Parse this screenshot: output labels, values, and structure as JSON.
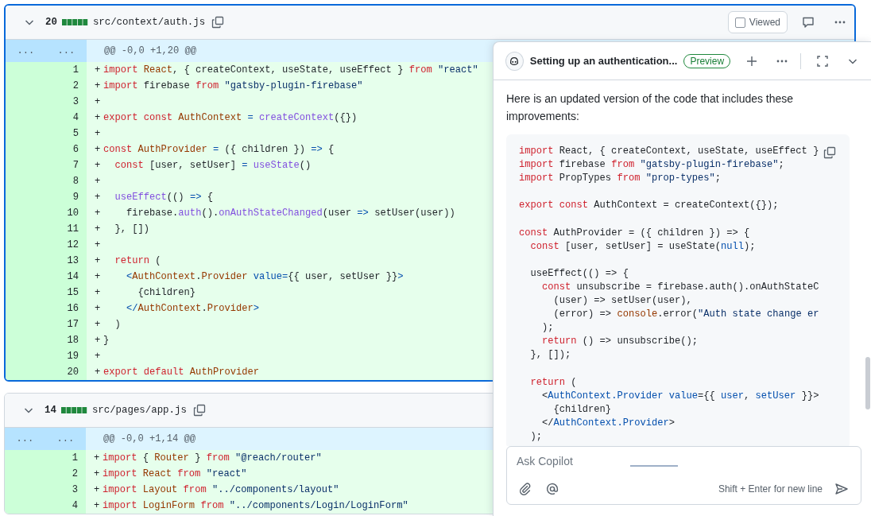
{
  "files": [
    {
      "focused": true,
      "collapsed": false,
      "count": "20",
      "path": "src/context/auth.js",
      "viewed": false,
      "viewed_label": "Viewed",
      "hunk": {
        "old_marker": "...",
        "new_marker": "...",
        "header": "@@ -0,0 +1,20 @@"
      },
      "lines": [
        {
          "number": "1",
          "sign": "+",
          "tokens": [
            {
              "text": "import",
              "kind": "keyword"
            },
            {
              "text": " React",
              "kind": "entity"
            },
            {
              "text": ", { createContext, useState, useEffect } "
            },
            {
              "text": "from",
              "kind": "keyword"
            },
            {
              "text": " \"react\"",
              "kind": "string"
            }
          ]
        },
        {
          "number": "2",
          "sign": "+",
          "tokens": [
            {
              "text": "import",
              "kind": "keyword"
            },
            {
              "text": " firebase "
            },
            {
              "text": "from",
              "kind": "keyword"
            },
            {
              "text": " \"gatsby-plugin-firebase\"",
              "kind": "string"
            }
          ]
        },
        {
          "number": "3",
          "sign": "+"
        },
        {
          "number": "4",
          "sign": "+",
          "tokens": [
            {
              "text": "export",
              "kind": "keyword"
            },
            {
              "text": " const",
              "kind": "keyword"
            },
            {
              "text": " AuthContext",
              "kind": "entity"
            },
            {
              "text": " =",
              "kind": "constant"
            },
            {
              "text": " createContext",
              "kind": "function"
            },
            {
              "text": "({})"
            }
          ]
        },
        {
          "number": "5",
          "sign": "+"
        },
        {
          "number": "6",
          "sign": "+",
          "tokens": [
            {
              "text": "const",
              "kind": "keyword"
            },
            {
              "text": " AuthProvider",
              "kind": "entity"
            },
            {
              "text": " =",
              "kind": "constant"
            },
            {
              "text": " ({ children }) "
            },
            {
              "text": "=>",
              "kind": "constant"
            },
            {
              "text": " {"
            }
          ]
        },
        {
          "number": "7",
          "sign": "+",
          "tokens": [
            {
              "text": "  const",
              "kind": "keyword"
            },
            {
              "text": " [user, setUser] "
            },
            {
              "text": "=",
              "kind": "constant"
            },
            {
              "text": " useState",
              "kind": "function"
            },
            {
              "text": "()"
            }
          ]
        },
        {
          "number": "8",
          "sign": "+"
        },
        {
          "number": "9",
          "sign": "+",
          "tokens": [
            {
              "text": "  useEffect",
              "kind": "function"
            },
            {
              "text": "(() "
            },
            {
              "text": "=>",
              "kind": "constant"
            },
            {
              "text": " {"
            }
          ]
        },
        {
          "number": "10",
          "sign": "+",
          "tokens": [
            {
              "text": "    firebase."
            },
            {
              "text": "auth",
              "kind": "function"
            },
            {
              "text": "()."
            },
            {
              "text": "onAuthStateChanged",
              "kind": "function"
            },
            {
              "text": "(user "
            },
            {
              "text": "=>",
              "kind": "constant"
            },
            {
              "text": " setUser(user))"
            }
          ]
        },
        {
          "number": "11",
          "sign": "+",
          "tokens": [
            {
              "text": "  }, [])"
            }
          ]
        },
        {
          "number": "12",
          "sign": "+"
        },
        {
          "number": "13",
          "sign": "+",
          "tokens": [
            {
              "text": "  return",
              "kind": "keyword"
            },
            {
              "text": " ("
            }
          ]
        },
        {
          "number": "14",
          "sign": "+",
          "tokens": [
            {
              "text": "    <",
              "kind": "constant"
            },
            {
              "text": "AuthContext",
              "kind": "entity"
            },
            {
              "text": "."
            },
            {
              "text": "Provider",
              "kind": "entity"
            },
            {
              "text": " value=",
              "kind": "constant"
            },
            {
              "text": "{{ user, setUser }}"
            },
            {
              "text": ">",
              "kind": "constant"
            }
          ]
        },
        {
          "number": "15",
          "sign": "+",
          "tokens": [
            {
              "text": "      {children}"
            }
          ]
        },
        {
          "number": "16",
          "sign": "+",
          "tokens": [
            {
              "text": "    </",
              "kind": "constant"
            },
            {
              "text": "AuthContext",
              "kind": "entity"
            },
            {
              "text": "."
            },
            {
              "text": "Provider",
              "kind": "entity"
            },
            {
              "text": ">",
              "kind": "constant"
            }
          ]
        },
        {
          "number": "17",
          "sign": "+",
          "tokens": [
            {
              "text": "  )"
            }
          ]
        },
        {
          "number": "18",
          "sign": "+",
          "tokens": [
            {
              "text": "}"
            }
          ]
        },
        {
          "number": "19",
          "sign": "+"
        },
        {
          "number": "20",
          "sign": "+",
          "tokens": [
            {
              "text": "export",
              "kind": "keyword"
            },
            {
              "text": " default",
              "kind": "keyword"
            },
            {
              "text": " AuthProvider",
              "kind": "entity"
            }
          ]
        }
      ]
    },
    {
      "focused": false,
      "collapsed": false,
      "count": "14",
      "path": "src/pages/app.js",
      "hunk": {
        "old_marker": "...",
        "new_marker": "...",
        "header": "@@ -0,0 +1,14 @@"
      },
      "lines": [
        {
          "number": "1",
          "sign": "+",
          "tokens": [
            {
              "text": "import",
              "kind": "keyword"
            },
            {
              "text": " { "
            },
            {
              "text": "Router",
              "kind": "entity"
            },
            {
              "text": " } "
            },
            {
              "text": "from",
              "kind": "keyword"
            },
            {
              "text": " \"@reach/router\"",
              "kind": "string"
            }
          ]
        },
        {
          "number": "2",
          "sign": "+",
          "tokens": [
            {
              "text": "import",
              "kind": "keyword"
            },
            {
              "text": " React",
              "kind": "entity"
            },
            {
              "text": " from",
              "kind": "keyword"
            },
            {
              "text": " \"react\"",
              "kind": "string"
            }
          ]
        },
        {
          "number": "3",
          "sign": "+",
          "tokens": [
            {
              "text": "import",
              "kind": "keyword"
            },
            {
              "text": " Layout",
              "kind": "entity"
            },
            {
              "text": " from",
              "kind": "keyword"
            },
            {
              "text": " \"../components/layout\"",
              "kind": "string"
            }
          ]
        },
        {
          "number": "4",
          "sign": "+",
          "tokens": [
            {
              "text": "import",
              "kind": "keyword"
            },
            {
              "text": " LoginForm",
              "kind": "entity"
            },
            {
              "text": " from",
              "kind": "keyword"
            },
            {
              "text": " \"../components/Login/LoginForm\"",
              "kind": "string"
            }
          ]
        }
      ]
    }
  ],
  "copilot": {
    "title": "Setting up an authentication...",
    "badge": "Preview",
    "message": "Here is an updated version of the code that includes these improvements:",
    "code": [
      {
        "tokens": [
          {
            "text": "import",
            "kind": "keyword"
          },
          {
            "text": " React, { createContext, useState, useEffect }"
          }
        ]
      },
      {
        "tokens": [
          {
            "text": "import",
            "kind": "keyword"
          },
          {
            "text": " firebase "
          },
          {
            "text": "from",
            "kind": "keyword"
          },
          {
            "text": " \"gatsby-plugin-firebase\"",
            "kind": "string"
          },
          {
            "text": ";"
          }
        ]
      },
      {
        "tokens": [
          {
            "text": "import",
            "kind": "keyword"
          },
          {
            "text": " PropTypes "
          },
          {
            "text": "from",
            "kind": "keyword"
          },
          {
            "text": " \"prop-types\"",
            "kind": "string"
          },
          {
            "text": ";"
          }
        ]
      },
      {
        "blank_before": true,
        "tokens": [
          {
            "text": "export",
            "kind": "keyword"
          },
          {
            "text": " const",
            "kind": "keyword"
          },
          {
            "text": " AuthContext = createContext({});"
          }
        ]
      },
      {
        "blank_before": true,
        "tokens": [
          {
            "text": "const",
            "kind": "keyword"
          },
          {
            "text": " AuthProvider = ({ children }) => {"
          }
        ]
      },
      {
        "tokens": [
          {
            "text": "  const",
            "kind": "keyword"
          },
          {
            "text": " [user, setUser] = useState("
          },
          {
            "text": "null",
            "kind": "constant"
          },
          {
            "text": ");"
          }
        ]
      },
      {
        "blank_before": true,
        "tokens": [
          {
            "text": "  useEffect(() => {"
          }
        ]
      },
      {
        "tokens": [
          {
            "text": "    const",
            "kind": "keyword"
          },
          {
            "text": " unsubscribe = firebase.auth().onAuthStateC"
          }
        ]
      },
      {
        "tokens": [
          {
            "text": "      (user) => setUser(user),"
          }
        ]
      },
      {
        "tokens": [
          {
            "text": "      (error) => "
          },
          {
            "text": "console",
            "kind": "entity"
          },
          {
            "text": ".error("
          },
          {
            "text": "\"Auth state change er",
            "kind": "string"
          }
        ]
      },
      {
        "tokens": [
          {
            "text": "    );"
          }
        ]
      },
      {
        "tokens": [
          {
            "text": "    return",
            "kind": "keyword"
          },
          {
            "text": " () => unsubscribe();"
          }
        ]
      },
      {
        "tokens": [
          {
            "text": "  }, []);"
          }
        ]
      },
      {
        "blank_before": true,
        "tokens": [
          {
            "text": "  return",
            "kind": "keyword"
          },
          {
            "text": " ("
          }
        ]
      },
      {
        "tokens": [
          {
            "text": "    <"
          },
          {
            "text": "AuthContext.Provider value",
            "kind": "constant"
          },
          {
            "text": "={{ "
          },
          {
            "text": "user",
            "kind": "constant"
          },
          {
            "text": ", "
          },
          {
            "text": "setUser",
            "kind": "constant"
          },
          {
            "text": " }}>"
          }
        ]
      },
      {
        "tokens": [
          {
            "text": "      {children}"
          }
        ]
      },
      {
        "tokens": [
          {
            "text": "    </"
          },
          {
            "text": "AuthContext.Provider",
            "kind": "constant"
          },
          {
            "text": ">"
          }
        ]
      },
      {
        "tokens": [
          {
            "text": "  );"
          }
        ]
      }
    ],
    "input": {
      "placeholder": "Ask Copilot",
      "hint": "Shift + Enter for new line"
    }
  }
}
